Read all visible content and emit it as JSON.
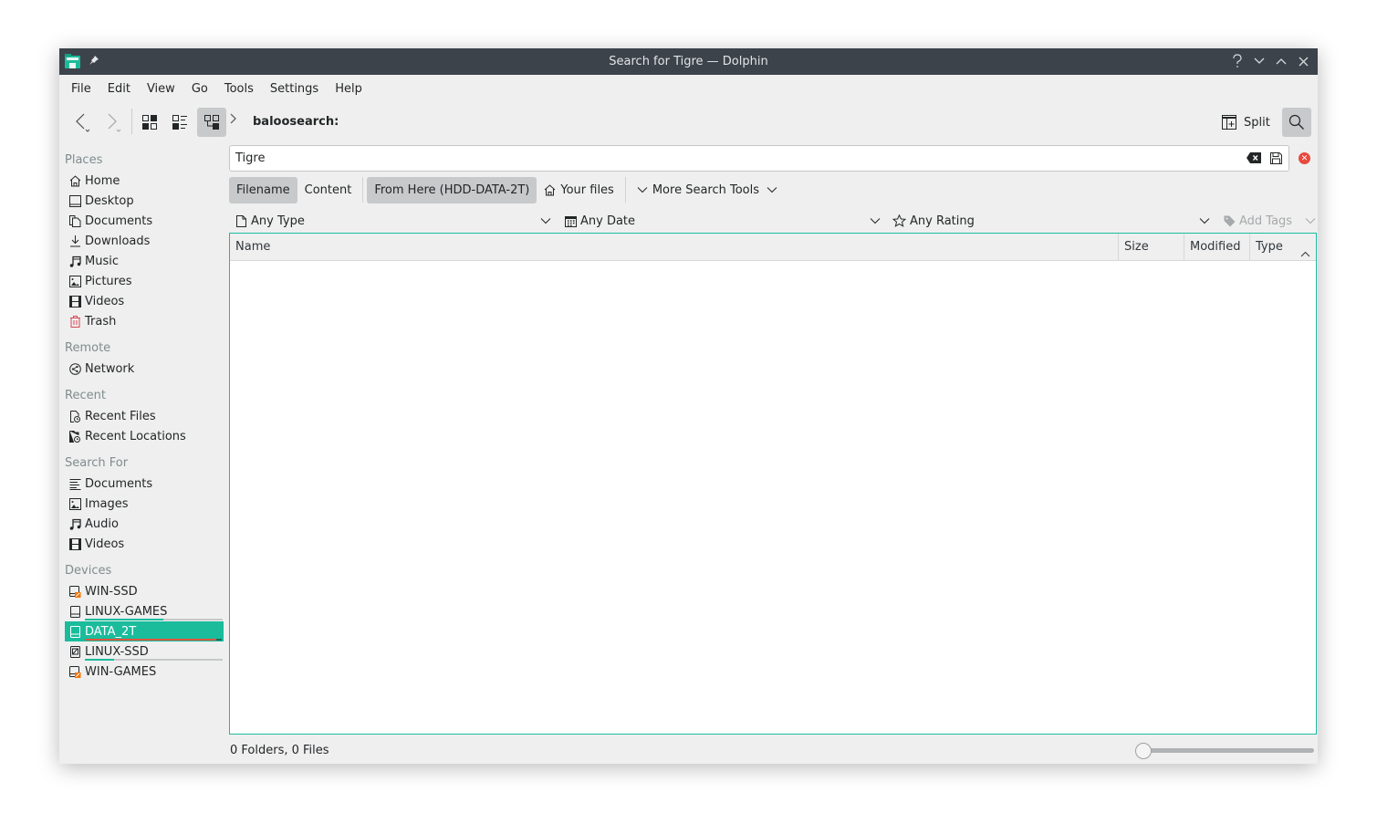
{
  "window": {
    "title": "Search for Tigre — Dolphin",
    "accent_color": "#1abc9c",
    "titlebar_buttons": [
      "help",
      "minimize",
      "maximize",
      "close"
    ]
  },
  "menubar": {
    "items": [
      "File",
      "Edit",
      "View",
      "Go",
      "Tools",
      "Settings",
      "Help"
    ]
  },
  "toolbar": {
    "back_icon": "back-icon",
    "forward_icon": "forward-icon",
    "view_modes": [
      "icons-view",
      "compact-view",
      "details-view"
    ],
    "active_view_mode": "details-view",
    "breadcrumb": "baloosearch:",
    "split_label": "Split",
    "search_active": true
  },
  "sidebar": {
    "groups": [
      {
        "heading": "Places",
        "items": [
          {
            "label": "Home",
            "icon": "home-icon"
          },
          {
            "label": "Desktop",
            "icon": "desktop-icon"
          },
          {
            "label": "Documents",
            "icon": "documents-icon"
          },
          {
            "label": "Downloads",
            "icon": "downloads-icon"
          },
          {
            "label": "Music",
            "icon": "music-icon"
          },
          {
            "label": "Pictures",
            "icon": "pictures-icon"
          },
          {
            "label": "Videos",
            "icon": "videos-icon"
          },
          {
            "label": "Trash",
            "icon": "trash-icon"
          }
        ]
      },
      {
        "heading": "Remote",
        "items": [
          {
            "label": "Network",
            "icon": "network-icon"
          }
        ]
      },
      {
        "heading": "Recent",
        "items": [
          {
            "label": "Recent Files",
            "icon": "recent-files-icon"
          },
          {
            "label": "Recent Locations",
            "icon": "recent-locations-icon"
          }
        ]
      },
      {
        "heading": "Search For",
        "items": [
          {
            "label": "Documents",
            "icon": "text-documents-icon"
          },
          {
            "label": "Images",
            "icon": "images-icon"
          },
          {
            "label": "Audio",
            "icon": "audio-icon"
          },
          {
            "label": "Videos",
            "icon": "videos-icon"
          }
        ]
      },
      {
        "heading": "Devices",
        "items": [
          {
            "label": "WIN-SSD",
            "icon": "drive-unmounted-icon"
          },
          {
            "label": "LINUX-GAMES",
            "icon": "drive-icon",
            "capacity_used": 0.57
          },
          {
            "label": "DATA_2T",
            "icon": "drive-icon",
            "capacity_used": 0.96,
            "selected": true
          },
          {
            "label": "LINUX-SSD",
            "icon": "ssd-icon",
            "capacity_used": 0.21
          },
          {
            "label": "WIN-GAMES",
            "icon": "drive-unmounted-icon"
          }
        ]
      }
    ]
  },
  "search": {
    "query": "Tigre",
    "clear_icon": "clear-icon",
    "save_icon": "save-icon",
    "close_icon": "close-search-icon",
    "filters": {
      "filename_label": "Filename",
      "content_label": "Content",
      "from_here_label": "From Here (HDD-DATA-2T)",
      "your_files_label": "Your files",
      "more_tools_label": "More Search Tools",
      "selected": [
        "Filename",
        "From Here (HDD-DATA-2T)"
      ]
    },
    "facets": {
      "type": "Any Type",
      "date": "Any Date",
      "rating": "Any Rating",
      "tags": "Add Tags"
    }
  },
  "view": {
    "columns": [
      "Name",
      "Size",
      "Modified",
      "Type"
    ],
    "sort_column": "Type",
    "sort_order": "ascending",
    "rows": []
  },
  "statusbar": {
    "text": "0 Folders, 0 Files",
    "zoom_level": 0
  }
}
